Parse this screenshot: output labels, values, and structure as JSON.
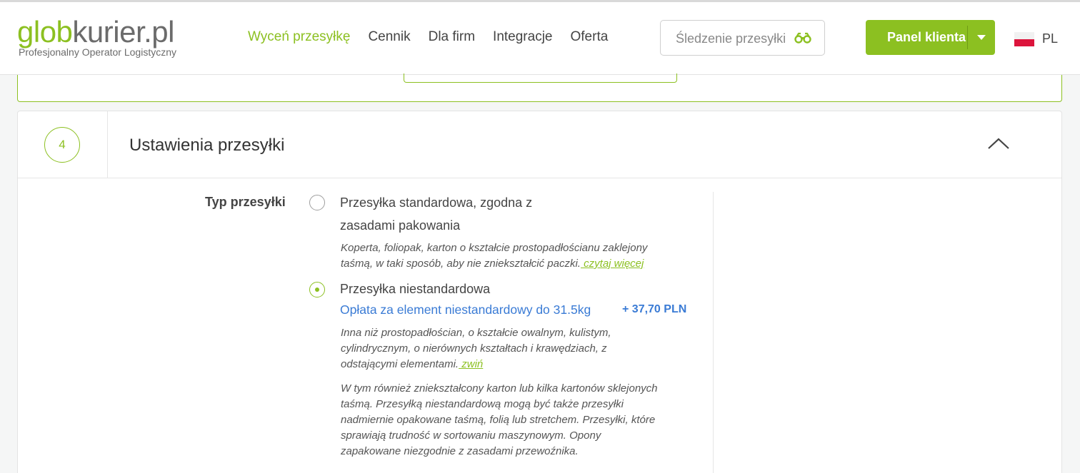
{
  "header": {
    "logo": {
      "main_a": "glob",
      "main_b": "kurier.pl",
      "subtitle": "Profesjonalny Operator Logistyczny"
    },
    "nav": [
      "Wyceń przesyłkę",
      "Cennik",
      "Dla firm",
      "Integracje",
      "Oferta"
    ],
    "tracking": {
      "label": "Śledzenie przesyłki",
      "icon": "binoculars-icon"
    },
    "panel_button": {
      "label": "Panel klienta"
    },
    "language": {
      "code": "PL"
    },
    "colors": {
      "accent": "#8cc021",
      "link_blue": "#3a7bd5"
    }
  },
  "section": {
    "step_number": "4",
    "title": "Ustawienia przesyłki",
    "field_label": "Typ przesyłki",
    "options": [
      {
        "title_line1": "Przesyłka standardowa, zgodna z",
        "title_line2": "zasadami pakowania",
        "selected": false,
        "desc_line1": "Koperta, foliopak, karton o kształcie prostopadłościanu zaklejony",
        "desc_line2": "taśmą, w taki sposób, aby nie zniekształcić paczki.",
        "link": " czytaj więcej"
      },
      {
        "title": "Przesyłka niestandardowa",
        "selected": true,
        "fee_label": "Opłata za element niestandardowy do 31.5kg",
        "fee_value": "+ 37,70 PLN",
        "desc_line1": "Inna niż prostopadłościan, o kształcie owalnym, kulistym,",
        "desc_line2": "cylindrycznym, o nierównych kształtach i krawędziach, z",
        "desc_line3": "odstającymi elementami.",
        "link": " zwiń",
        "extra_lines": [
          "W tym również zniekształcony karton lub kilka kartonów sklejonych",
          "taśmą. Przesyłką niestandardową mogą być także przesyłki",
          "nadmiernie opakowane taśmą, folią lub stretchem. Przesyłki, które",
          "sprawiają trudność w sortowaniu maszynowym. Opony",
          "zapakowane niezgodnie z zasadami przewoźnika."
        ]
      }
    ]
  }
}
